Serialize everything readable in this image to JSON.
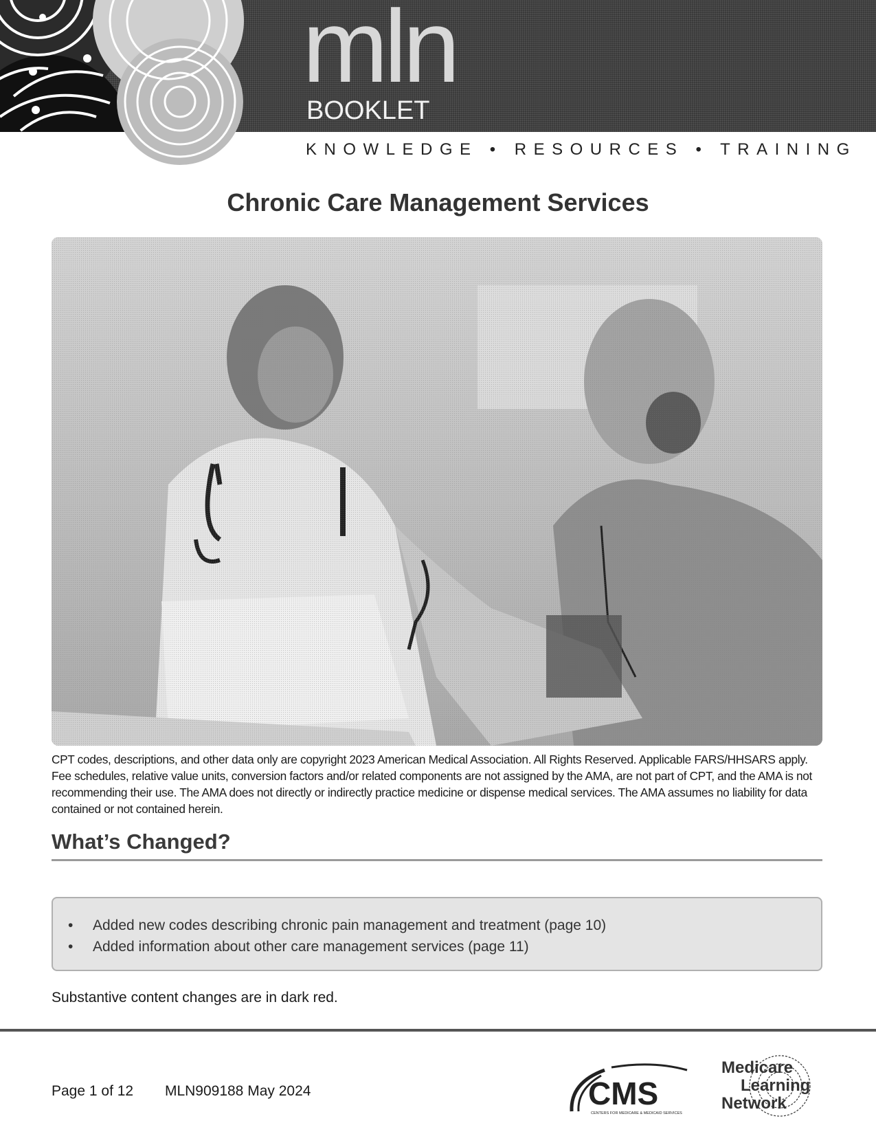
{
  "header": {
    "logo_text": "mln",
    "logo_subtitle": "BOOKLET",
    "tagline": "KNOWLEDGE • RESOURCES • TRAINING"
  },
  "document": {
    "title": "Chronic Care Management Services",
    "hero_image_alt": "Doctor taking an older patient's blood pressure at a desk with a laptop",
    "disclaimer": "CPT codes, descriptions, and other data only are copyright 2023 American Medical Association. All Rights Reserved. Applicable FARS/HHSARS apply. Fee schedules, relative value units, conversion factors and/or related components are not assigned by the AMA, are not part of CPT, and the AMA is not recommending their use. The AMA does not directly or indirectly practice medicine or dispense medical services. The AMA assumes no liability for data contained or not contained herein.",
    "whats_changed": {
      "heading": "What’s Changed?",
      "items": [
        "Added new codes describing chronic pain management and treatment (page 10)",
        "Added information about other care management services (page 11)"
      ]
    },
    "note": "Substantive content changes are in dark red."
  },
  "footer": {
    "page_label": "Page 1 of 12",
    "doc_id": "MLN909188 May 2024",
    "cms_logo_text": "CMS",
    "cms_logo_subtext": "CENTERS FOR MEDICARE & MEDICAID SERVICES",
    "mln_logo_lines": [
      "Medicare",
      "Learning",
      "Network"
    ]
  },
  "icons": {
    "bullet": "•"
  }
}
